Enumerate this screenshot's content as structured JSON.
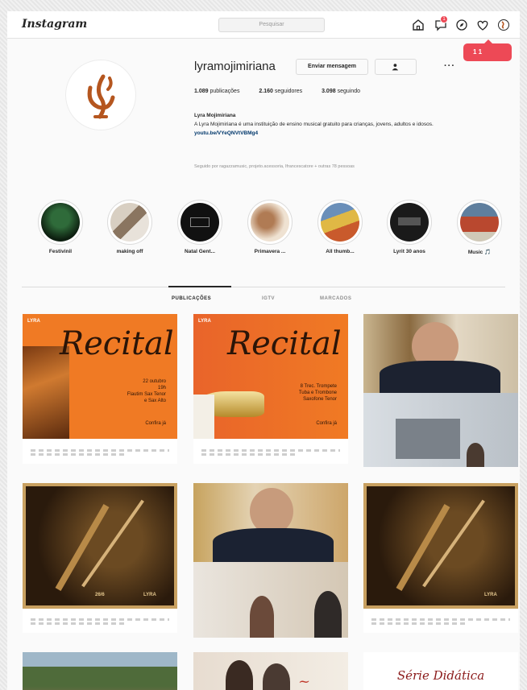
{
  "topbar": {
    "logo": "Instagram",
    "search_placeholder": "Pesquisar",
    "icons": [
      "home-icon",
      "messenger-icon",
      "explore-icon",
      "heart-icon",
      "avatar-icon"
    ],
    "dm_badge": "1"
  },
  "notification_pill": "1  1",
  "profile": {
    "username": "lyramojimiriana",
    "message_button": "Enviar mensagem",
    "follow_icon": "user-check-icon",
    "more": "···",
    "stats": [
      {
        "value": "1.089",
        "label": "publicações"
      },
      {
        "value": "2.160",
        "label": "seguidores"
      },
      {
        "value": "3.098",
        "label": "seguindo"
      }
    ],
    "bio_name": "Lyra Mojimiriana",
    "bio_text": "A Lyra Mojimiriana é uma instituição de ensino musical gratuito para crianças, jovens, adultos e idosos.",
    "bio_link": "youtu.be/VYeQNVtVBMg4",
    "followed_by": "Seguido por ragazzamusic, projeto.acessoria, lfrancescatore + outras 78 pessoas"
  },
  "highlights": [
    {
      "label": "Festivinil"
    },
    {
      "label": "making off"
    },
    {
      "label": "Natal Gent..."
    },
    {
      "label": "Primavera ..."
    },
    {
      "label": "All thumb..."
    },
    {
      "label": "Lyrit 30 anos"
    },
    {
      "label": "Music 🎵"
    }
  ],
  "tabs": [
    {
      "label": "PUBLICAÇÕES"
    },
    {
      "label": "IGTV"
    },
    {
      "label": "MARCADOS"
    }
  ],
  "posts": {
    "recital_title": "Recital",
    "recital_1_lines": [
      "22 outubro",
      "19h",
      "Flautim Sax Tenor",
      "e Sax Alto"
    ],
    "recital_2_lines": [
      "8 Trec. Trompete",
      "Tuba e Trombone",
      "Saxofone Tenor"
    ],
    "recital_cta": "Confira já",
    "lyra_flag": "LYRA",
    "serie_title": "Série Didática",
    "concert_date": "26/6"
  },
  "colors": {
    "orange": "#f07a24",
    "brand_red": "#ed4956",
    "accent_brown": "#b5561f"
  }
}
